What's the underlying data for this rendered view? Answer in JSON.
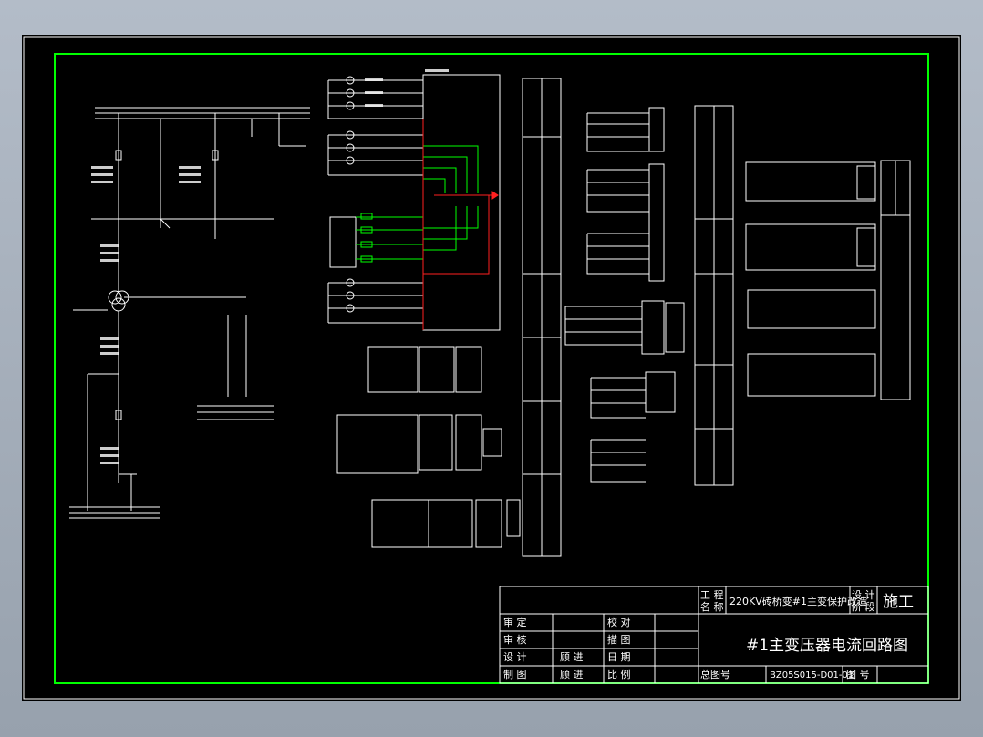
{
  "title_block": {
    "project_label": "工 程\n名 称",
    "project_label_l1": "工 程",
    "project_label_l2": "名 称",
    "project_name": "220KV砖桥变#1主变保护改造",
    "stage_label_l1": "设 计",
    "stage_label_l2": "阶 段",
    "stage_value": "施工",
    "drawing_title": "#1主变压器电流回路图",
    "rows": [
      {
        "role": "审    定",
        "name": "",
        "role2": "校    对",
        "name2": ""
      },
      {
        "role": "审    核",
        "name": "",
        "role2": "描    图",
        "name2": ""
      },
      {
        "role": "设    计",
        "name": "顾  进",
        "role2": "日    期",
        "name2": ""
      },
      {
        "role": "制    图",
        "name": "顾  进",
        "role2": "比    例",
        "name2": ""
      }
    ],
    "drawing_no_label": "总图号",
    "drawing_no": "BZ05S015-D01-01",
    "sheet_no_label": "图  号"
  },
  "colors": {
    "sheet_bg": "#000000",
    "border_outer": "#ffffff",
    "border_inner": "#00ff00",
    "line": "#ffffff",
    "green": "#00ff00",
    "red": "#ff2020",
    "accent_text": "#ffff66"
  }
}
